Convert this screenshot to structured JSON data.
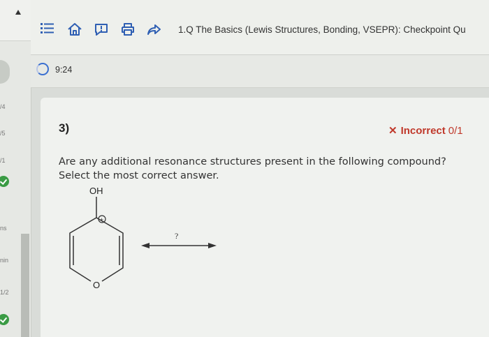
{
  "sidebar": {
    "items": [
      {
        "label": "/4"
      },
      {
        "label": "/5"
      },
      {
        "label": "/1"
      },
      {
        "label": "ns"
      },
      {
        "label": "nin"
      },
      {
        "label": "1/2"
      }
    ]
  },
  "toolbar": {
    "title": "1.Q The Basics (Lewis Structures, Bonding, VSEPR): Checkpoint Qu",
    "icons": [
      "list-icon",
      "home-icon",
      "report-icon",
      "print-icon",
      "share-icon"
    ]
  },
  "timer": {
    "value": "9:24"
  },
  "question": {
    "number": "3)",
    "status_label": "Incorrect",
    "score": "0/1",
    "prompt_line1": "Are any additional resonance structures present in the following compound?",
    "prompt_line2": "Select the most correct answer.",
    "molecule": {
      "substituent": "OH",
      "ring_atom": "O",
      "charge": "+",
      "arrow_label": "?"
    }
  },
  "colors": {
    "incorrect": "#c0392b",
    "timer_ring": "#3a6fd0",
    "check": "#3a9b44"
  }
}
